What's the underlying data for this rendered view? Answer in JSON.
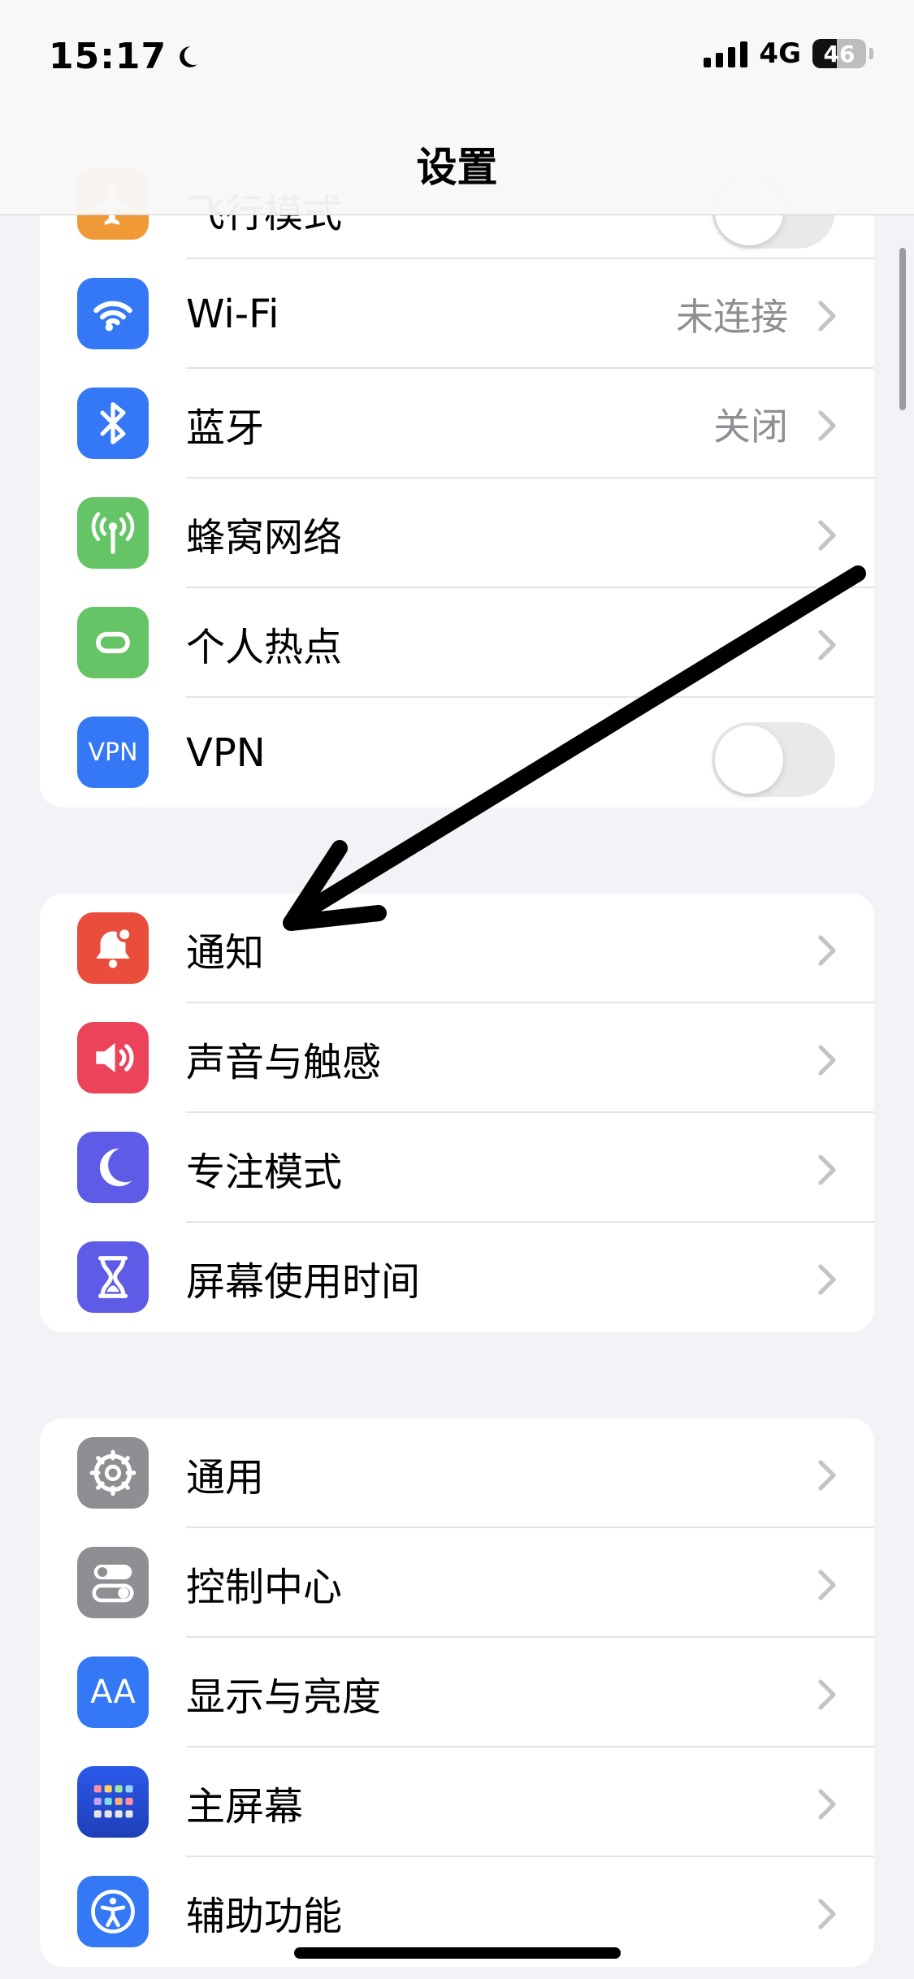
{
  "status_bar": {
    "time": "15:17",
    "network": "4G",
    "battery": "46",
    "battery_level": 0.46
  },
  "nav": {
    "title": "设置"
  },
  "groups": [
    {
      "items": [
        {
          "label": "飞行模式",
          "type": "toggle",
          "on": false,
          "icon": "airplane-icon",
          "color": "#f09a37"
        },
        {
          "label": "Wi-Fi",
          "value": "未连接",
          "icon": "wifi-icon",
          "color": "#3478f6"
        },
        {
          "label": "蓝牙",
          "value": "关闭",
          "icon": "bluetooth-icon",
          "color": "#3478f6"
        },
        {
          "label": "蜂窝网络",
          "icon": "cellular-icon",
          "color": "#65c466"
        },
        {
          "label": "个人热点",
          "icon": "hotspot-icon",
          "color": "#65c466"
        },
        {
          "label": "VPN",
          "type": "toggle",
          "on": false,
          "icon": "vpn-icon",
          "icon_text": "VPN",
          "color": "#3478f6"
        }
      ]
    },
    {
      "items": [
        {
          "label": "通知",
          "icon": "notification-bell-icon",
          "color": "#eb4d3d"
        },
        {
          "label": "声音与触感",
          "icon": "speaker-icon",
          "color": "#eb445a"
        },
        {
          "label": "专注模式",
          "icon": "moon-icon",
          "color": "#5e5ce6"
        },
        {
          "label": "屏幕使用时间",
          "icon": "hourglass-icon",
          "color": "#5e5ce6"
        }
      ]
    },
    {
      "items": [
        {
          "label": "通用",
          "icon": "gear-icon",
          "color": "#8e8e93"
        },
        {
          "label": "控制中心",
          "icon": "control-center-icon",
          "color": "#8e8e93"
        },
        {
          "label": "显示与亮度",
          "icon": "display-brightness-icon",
          "icon_text": "AA",
          "color": "#3478f6"
        },
        {
          "label": "主屏幕",
          "icon": "home-screen-icon",
          "color": "#2f54eb"
        },
        {
          "label": "辅助功能",
          "icon": "accessibility-icon",
          "color": "#3478f6"
        }
      ]
    }
  ],
  "annotation": {
    "color": "#000000"
  }
}
